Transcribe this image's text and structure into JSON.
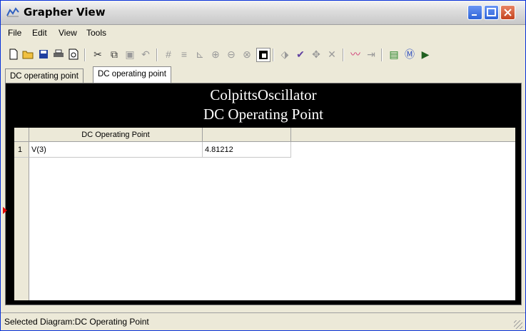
{
  "window": {
    "title": "Grapher View"
  },
  "menu": {
    "items": [
      "File",
      "Edit",
      "View",
      "Tools"
    ]
  },
  "tabs": [
    "DC operating point",
    "DC operating point"
  ],
  "panel": {
    "title_line1": "ColpittsOscillator",
    "title_line2": "DC Operating Point"
  },
  "table": {
    "columns": [
      "DC Operating Point",
      ""
    ],
    "rows": [
      {
        "index": "1",
        "name": "V(3)",
        "value": "4.81212"
      }
    ]
  },
  "status": {
    "text": "Selected Diagram:DC Operating Point"
  }
}
